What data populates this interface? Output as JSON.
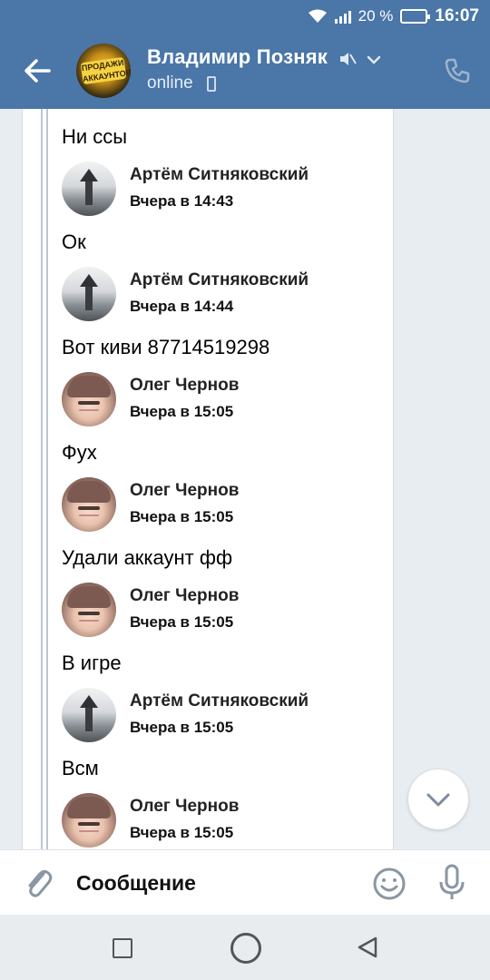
{
  "status_bar": {
    "battery": "20 %",
    "time": "16:07"
  },
  "header": {
    "contact_name": "Владимир Позняк",
    "status": "online",
    "avatar_label": "ПРОДАЖИ АККАУНТОВ"
  },
  "messages": [
    {
      "type": "text",
      "text": "Ни ссы"
    },
    {
      "type": "author",
      "author": "Артём Ситняковский",
      "time": "Вчера в 14:43",
      "avatar": "tower"
    },
    {
      "type": "text",
      "text": "Ок"
    },
    {
      "type": "author",
      "author": "Артём Ситняковский",
      "time": "Вчера в 14:44",
      "avatar": "tower"
    },
    {
      "type": "text",
      "text": "Вот киви 87714519298"
    },
    {
      "type": "author",
      "author": "Олег Чернов",
      "time": "Вчера в 15:05",
      "avatar": "anime"
    },
    {
      "type": "text",
      "text": "Фух"
    },
    {
      "type": "author",
      "author": "Олег Чернов",
      "time": "Вчера в 15:05",
      "avatar": "anime"
    },
    {
      "type": "text",
      "text": "Удали аккаунт фф"
    },
    {
      "type": "author",
      "author": "Олег Чернов",
      "time": "Вчера в 15:05",
      "avatar": "anime"
    },
    {
      "type": "text",
      "text": "В игре"
    },
    {
      "type": "author",
      "author": "Артём Ситняковский",
      "time": "Вчера в 15:05",
      "avatar": "tower"
    },
    {
      "type": "text",
      "text": "Всм"
    },
    {
      "type": "author",
      "author": "Олег Чернов",
      "time": "Вчера в 15:05",
      "avatar": "anime"
    }
  ],
  "input": {
    "placeholder": "Сообщение"
  },
  "colors": {
    "header": "#4a76a8",
    "chat_background": "#e8edf2"
  }
}
